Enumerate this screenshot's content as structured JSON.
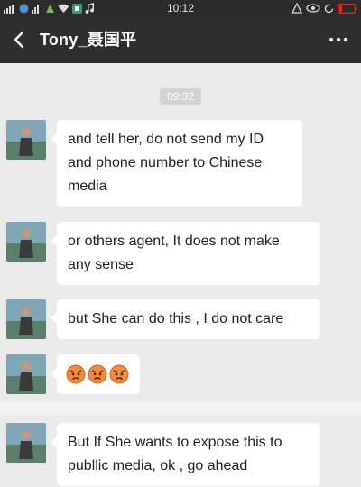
{
  "status_bar": {
    "time": "10:12"
  },
  "header": {
    "title": "Tony_聂国平",
    "back_icon": "chevron-left-icon",
    "more_icon": "more-dots-icon"
  },
  "chat": {
    "timestamp": "09:32",
    "messages": [
      {
        "lines": [
          "and tell her, do not send my ID",
          "and phone number to Chinese",
          "media"
        ]
      },
      {
        "lines": [
          "or others agent, It does not make",
          "any sense"
        ]
      },
      {
        "lines": [
          "but She can do this , I do not care"
        ]
      },
      {
        "emoji": [
          "angry-face-icon",
          "angry-face-icon",
          "angry-face-icon"
        ]
      },
      {
        "lines": [
          "But If She wants to expose this to",
          "publlic media, ok , go ahead"
        ]
      }
    ]
  },
  "colors": {
    "titlebar_bg": "#2e2e2e",
    "chat_bg": "#ebebeb",
    "bubble_bg": "#ffffff",
    "timestamp_bg": "#d2d2d2"
  }
}
